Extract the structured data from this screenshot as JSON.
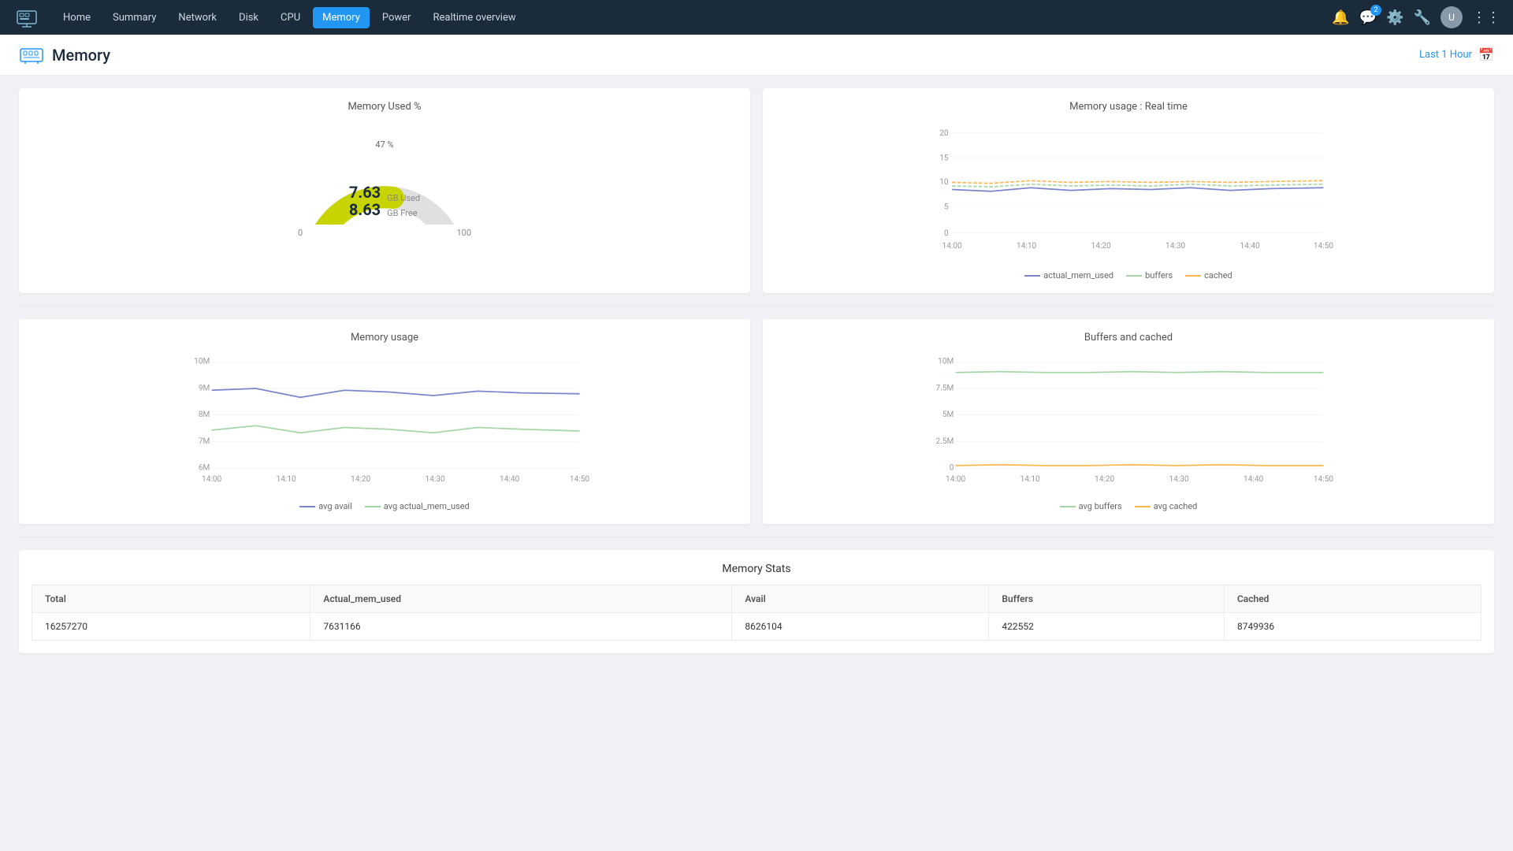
{
  "nav": {
    "logo_icon": "server-icon",
    "items": [
      {
        "label": "Home",
        "active": false
      },
      {
        "label": "Summary",
        "active": false
      },
      {
        "label": "Network",
        "active": false
      },
      {
        "label": "Disk",
        "active": false
      },
      {
        "label": "CPU",
        "active": false
      },
      {
        "label": "Memory",
        "active": true
      },
      {
        "label": "Power",
        "active": false
      },
      {
        "label": "Realtime overview",
        "active": false
      }
    ],
    "badge_count": "2",
    "avatar_text": "U"
  },
  "page": {
    "title": "Memory",
    "time_filter": "Last 1 Hour"
  },
  "gauge": {
    "title": "Memory Used %",
    "percent_label": "47 %",
    "gb_used_value": "7.63",
    "gb_used_label": "GB Used",
    "gb_free_value": "8.63",
    "gb_free_label": "GB Free",
    "min_label": "0",
    "max_label": "100",
    "fill_percent": 47
  },
  "realtime_chart": {
    "title": "Memory usage : Real time",
    "y_labels": [
      "20",
      "15",
      "10",
      "5",
      "0"
    ],
    "x_labels": [
      "14:00",
      "14:10",
      "14:20",
      "14:30",
      "14:40",
      "14:50"
    ],
    "legend": [
      {
        "label": "actual_mem_used",
        "color": "#7986cb"
      },
      {
        "label": "buffers",
        "color": "#a5d6a7"
      },
      {
        "label": "cached",
        "color": "#ffcc80"
      }
    ]
  },
  "memory_usage_chart": {
    "title": "Memory usage",
    "y_labels": [
      "10M",
      "9M",
      "8M",
      "7M",
      "6M"
    ],
    "x_labels": [
      "14:00",
      "14:10",
      "14:20",
      "14:30",
      "14:40",
      "14:50"
    ],
    "legend": [
      {
        "label": "avg avail",
        "color": "#7986cb"
      },
      {
        "label": "avg actual_mem_used",
        "color": "#a5d6a7"
      }
    ]
  },
  "buffers_chart": {
    "title": "Buffers and cached",
    "y_labels": [
      "10M",
      "7.5M",
      "5M",
      "2.5M",
      "0"
    ],
    "x_labels": [
      "14:00",
      "14:10",
      "14:20",
      "14:30",
      "14:40",
      "14:50"
    ],
    "legend": [
      {
        "label": "avg buffers",
        "color": "#a5d6a7"
      },
      {
        "label": "avg cached",
        "color": "#ffcc80"
      }
    ]
  },
  "stats": {
    "title": "Memory Stats",
    "columns": [
      "Total",
      "Actual_mem_used",
      "Avail",
      "Buffers",
      "Cached"
    ],
    "rows": [
      [
        "16257270",
        "7631166",
        "8626104",
        "422552",
        "8749936"
      ]
    ]
  }
}
